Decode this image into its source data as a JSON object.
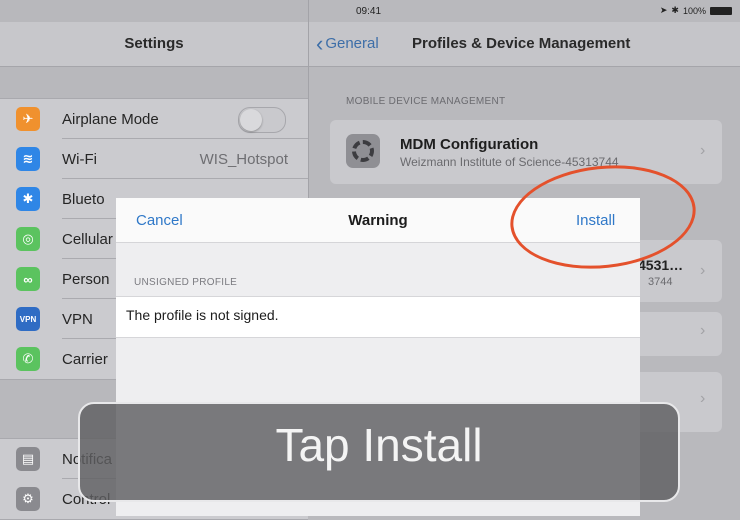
{
  "status_bar": {
    "time": "09:41",
    "battery": "100%"
  },
  "settings": {
    "title": "Settings",
    "items": [
      {
        "label": "Airplane Mode",
        "icon": "airplane-icon",
        "color": "#f0912e",
        "glyph": "✈"
      },
      {
        "label": "Wi-Fi",
        "value": "WIS_Hotspot",
        "icon": "wifi-icon",
        "color": "#2f86e6",
        "glyph": "≋"
      },
      {
        "label": "Blueto",
        "icon": "bluetooth-icon",
        "color": "#2f86e6",
        "glyph": "✱"
      },
      {
        "label": "Cellular",
        "icon": "cellular-icon",
        "color": "#5bc35f",
        "glyph": "◎"
      },
      {
        "label": "Person",
        "icon": "hotspot-icon",
        "color": "#5bc35f",
        "glyph": "∞"
      },
      {
        "label": "VPN",
        "icon": "vpn-icon",
        "color": "#2f6cc4",
        "glyph": "VPN"
      },
      {
        "label": "Carrier",
        "icon": "phone-icon",
        "color": "#5bc35f",
        "glyph": "✆"
      },
      {
        "label": "Notifica",
        "icon": "notifications-icon",
        "color": "#8a8a8f",
        "glyph": "▤"
      },
      {
        "label": "Control",
        "icon": "control-center-icon",
        "color": "#8a8a8f",
        "glyph": "⚙"
      }
    ]
  },
  "detail": {
    "back_label": "General",
    "title": "Profiles & Device Management",
    "section_label": "MOBILE DEVICE MANAGEMENT",
    "mdm_title": "MDM Configuration",
    "mdm_subtitle": "Weizmann Institute of Science-45313744",
    "peek_title": "4531…",
    "peek_subtitle": "3744"
  },
  "modal": {
    "cancel_label": "Cancel",
    "title": "Warning",
    "install_label": "Install",
    "section_label": "UNSIGNED PROFILE",
    "message": "The profile is not signed."
  },
  "overlay": {
    "text": "Tap Install"
  },
  "colors": {
    "ios_blue": "#2f78c8",
    "annotation_red": "#e4512c"
  }
}
